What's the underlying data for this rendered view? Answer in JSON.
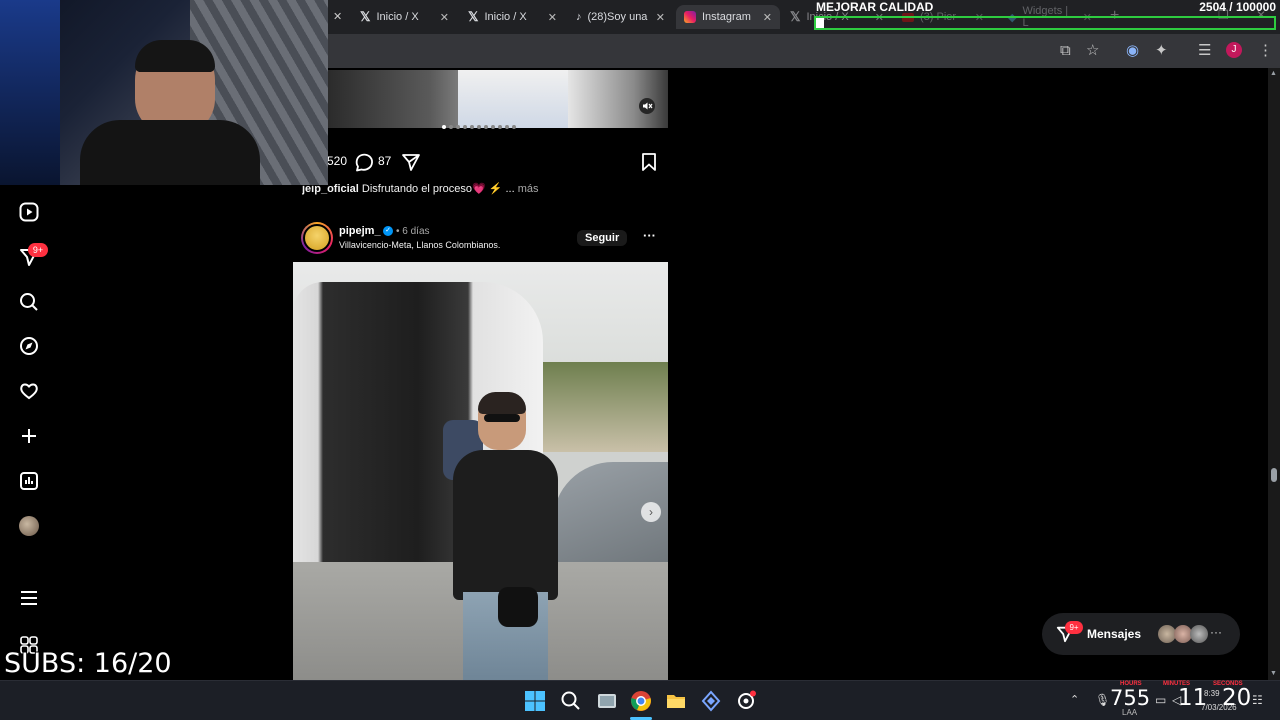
{
  "browser": {
    "tabs": [
      {
        "title": "Inicio / X"
      },
      {
        "title": "Inicio / X"
      },
      {
        "title": "(28)Soy una"
      },
      {
        "title": "Instagram"
      },
      {
        "title": "Inicio / X"
      },
      {
        "title": "(3) Pier"
      },
      {
        "title": "Widgets | L"
      }
    ],
    "close_glyph": "✕",
    "new_tab_glyph": "+",
    "profile_initial": "J"
  },
  "overlay": {
    "quality_label": "MEJORAR CALIDAD",
    "goal_counter": "2504 / 100000",
    "subs": "SUBS: 16/20"
  },
  "instagram": {
    "prev_post": {
      "likes": "520",
      "comments": "87",
      "caption_user": "jeip_oficial",
      "caption_text": "Disfrutando el proceso💗 ⚡ ...",
      "more": "más"
    },
    "post": {
      "username": "pipejm_",
      "age": "• 6 días",
      "location": "Villavicencio-Meta, Llanos Colombianos.",
      "follow": "Seguir",
      "more_options": "···"
    },
    "messages": {
      "label": "Mensajes",
      "badge": "9+"
    },
    "sidebar_badge": "9+"
  },
  "taskbar": {
    "mic_level": "755",
    "clock_big_left": "11",
    "clock_big_right": "20",
    "time": "8:39",
    "date": "7/03/2026",
    "lang": "LAA",
    "timer_labels": [
      "HOURS",
      "MINUTES",
      "SECONDS"
    ]
  },
  "colors": {
    "instagram_accent": "#ff3040",
    "verified": "#0095f6",
    "overlay_green": "#2ecc40",
    "chrome_bg": "#202124",
    "toolbar_bg": "#35363a"
  }
}
